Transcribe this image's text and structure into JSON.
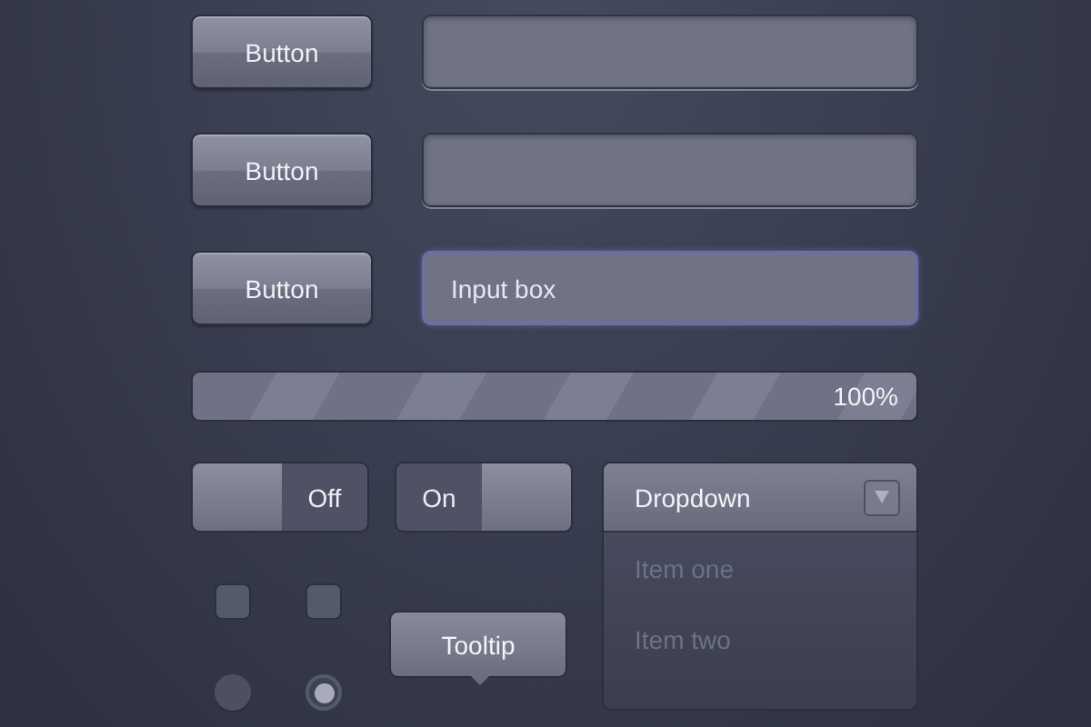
{
  "form_rows": [
    {
      "button": "Button",
      "input": {
        "focused": false
      }
    },
    {
      "button": "Button",
      "input": {
        "focused": false
      }
    },
    {
      "button": "Button",
      "input": {
        "value": "Input box",
        "focused": true
      }
    }
  ],
  "progress": {
    "level": 1,
    "reading": "100%"
  },
  "toggles": [
    {
      "label": "Off",
      "on": false
    },
    {
      "label": "On",
      "on": true
    }
  ],
  "checkboxes": [
    {
      "checked": false
    },
    {
      "checked": false
    }
  ],
  "radios": [
    {
      "selected": false
    },
    {
      "selected": true
    }
  ],
  "tooltip": {
    "text": "Tooltip"
  },
  "dropdown": {
    "label": "Dropdown",
    "expanded": true,
    "items": [
      "Item one",
      "Item two"
    ]
  }
}
